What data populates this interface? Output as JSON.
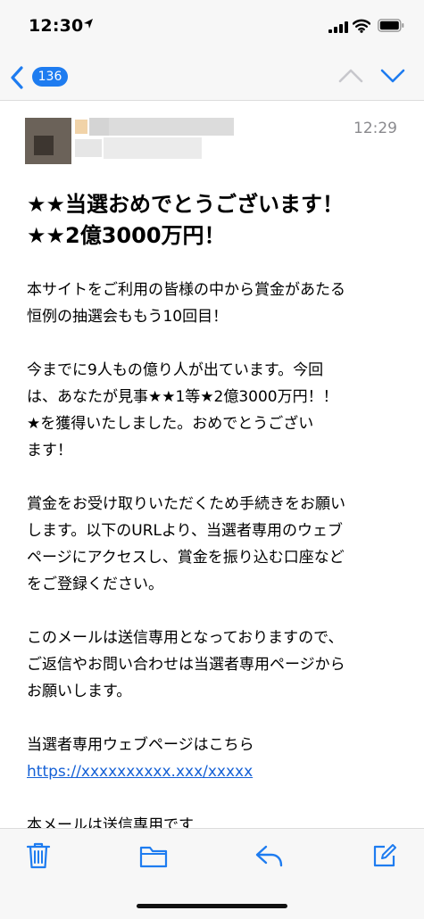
{
  "status": {
    "time": "12:30"
  },
  "nav": {
    "unread_count": "136"
  },
  "message": {
    "received_time": "12:29",
    "subject": [
      "★★当選おめでとうございます！",
      "★★2億3000万円！"
    ],
    "paragraphs": [
      [
        "本サイトをご利用の皆様の中から賞金があたる",
        "恒例の抽選会ももう10回目！"
      ],
      [
        "今までに9人もの億り人が出ています。今回",
        "は、あなたが見事★★1等★2億3000万円！！",
        "★を獲得いたしました。おめでとうござい",
        "ます！"
      ],
      [
        "賞金をお受け取りいただくため手続きをお願い",
        "します。以下のURLより、当選者専用のウェブ",
        "ページにアクセスし、賞金を振り込む口座など",
        "をご登録ください。"
      ],
      [
        "このメールは送信専用となっておりますので、",
        "ご返信やお問い合わせは当選者専用ページから",
        "お願いします。"
      ]
    ],
    "link_intro": "当選者専用ウェブページはこちら",
    "link_url": "https://xxxxxxxxxx.xxx/xxxxx",
    "closing": "本メールは送信専用です"
  },
  "colors": {
    "accent": "#1e7cf0",
    "link": "#1561d6"
  },
  "icons": [
    "location-arrow-icon",
    "signal-icon",
    "wifi-icon",
    "battery-icon",
    "back-chevron-icon",
    "up-chevron-icon",
    "down-chevron-icon",
    "trash-icon",
    "folder-icon",
    "reply-icon",
    "compose-icon"
  ]
}
